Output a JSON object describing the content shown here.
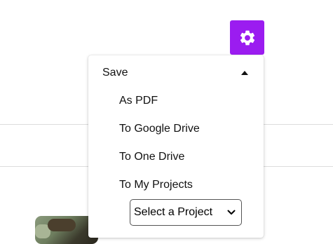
{
  "settings_button": {
    "icon": "gear-icon",
    "color": "#9b1cf0"
  },
  "save_menu": {
    "label": "Save",
    "toggle_icon": "caret-up-icon",
    "items": [
      {
        "label": "As PDF"
      },
      {
        "label": "To Google Drive"
      },
      {
        "label": "To One Drive"
      },
      {
        "label": "To My Projects"
      }
    ],
    "project_select": {
      "selected": "Select a Project"
    }
  }
}
